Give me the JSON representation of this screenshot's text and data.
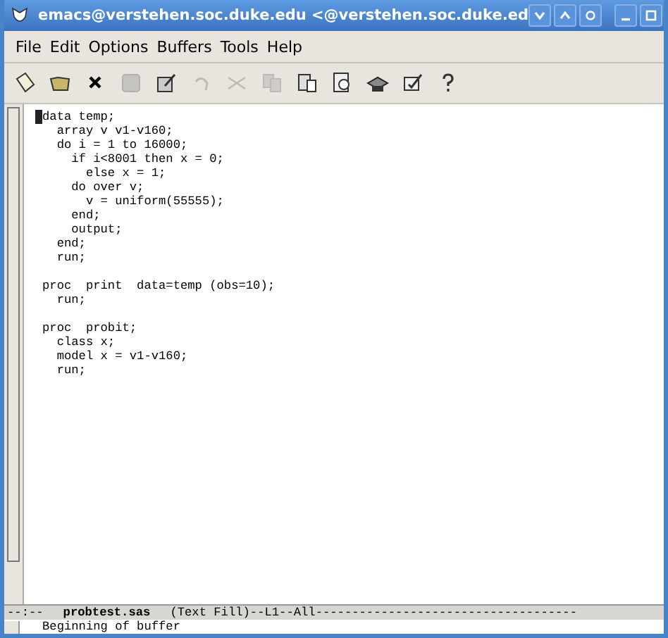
{
  "window": {
    "title": "emacs@verstehen.soc.duke.edu <@verstehen.soc.duke.ed"
  },
  "menu": [
    "File",
    "Edit",
    "Options",
    "Buffers",
    "Tools",
    "Help"
  ],
  "toolbar": [
    {
      "kind": "new",
      "disabled": false
    },
    {
      "kind": "open",
      "disabled": false
    },
    {
      "kind": "close",
      "disabled": false
    },
    {
      "kind": "save",
      "disabled": true
    },
    {
      "kind": "saveas",
      "disabled": false
    },
    {
      "kind": "undo",
      "disabled": true
    },
    {
      "kind": "cut",
      "disabled": true
    },
    {
      "kind": "copy",
      "disabled": true
    },
    {
      "kind": "paste",
      "disabled": false
    },
    {
      "kind": "search",
      "disabled": false
    },
    {
      "kind": "print",
      "disabled": false
    },
    {
      "kind": "spell",
      "disabled": false
    },
    {
      "kind": "help",
      "disabled": false
    }
  ],
  "editor": {
    "code": "data temp;\n  array v v1-v160;\n  do i = 1 to 16000;\n    if i<8001 then x = 0;\n      else x = 1;\n    do over v;\n      v = uniform(55555);\n    end;\n    output;\n  end;\n  run;\n\nproc  print  data=temp (obs=10);\n  run;\n\nproc  probit;\n  class x;\n  model x = v1-v160;\n  run;"
  },
  "mode_line": {
    "status": "--:--",
    "buffer": "probtest.sas",
    "modes": "(Text Fill)--L1--All------------------------------------"
  },
  "echo_area": "Beginning of buffer"
}
